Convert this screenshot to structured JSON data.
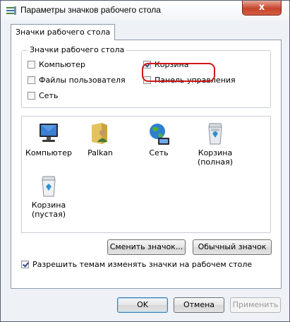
{
  "window": {
    "title": "Параметры значков рабочего стола",
    "close_label": "x"
  },
  "tab": {
    "label": "Значки рабочего стола"
  },
  "group": {
    "legend": "Значки рабочего стола",
    "checkboxes": [
      {
        "label": "Компьютер",
        "checked": false
      },
      {
        "label": "Корзина",
        "checked": true
      },
      {
        "label": "Файлы пользователя",
        "checked": false
      },
      {
        "label": "Панель управления",
        "checked": false
      },
      {
        "label": "Сеть",
        "checked": false
      }
    ]
  },
  "icons": [
    {
      "label": "Компьютер",
      "icon": "computer-icon"
    },
    {
      "label": "Palkan",
      "icon": "user-folder-icon"
    },
    {
      "label": "Сеть",
      "icon": "network-globe-icon"
    },
    {
      "label": "Корзина\n(полная)",
      "icon": "recycle-bin-full-icon"
    },
    {
      "label": "Корзина\n(пустая)",
      "icon": "recycle-bin-empty-icon"
    }
  ],
  "buttons": {
    "change_icon": "Сменить значок...",
    "default_icon": "Обычный значок",
    "ok": "OK",
    "cancel": "Отмена",
    "apply": "Применить"
  },
  "themes_checkbox": {
    "label": "Разрешить темам изменять значки на рабочем столе",
    "checked": true
  }
}
